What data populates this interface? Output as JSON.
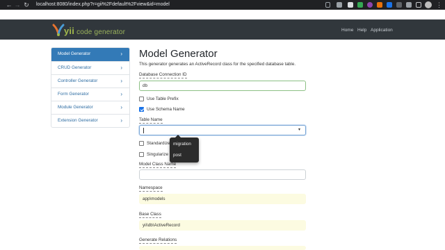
{
  "browser": {
    "url": "localhost:8080/index.php?r=gii%2Fdefault%2Fview&id=model",
    "back": "←",
    "forward": "→",
    "reload": "↻",
    "menu": "⋮"
  },
  "header": {
    "brand": "yii",
    "brand_suffix": "code generator",
    "nav": [
      "Home",
      "Help",
      "Application"
    ]
  },
  "sidebar": {
    "items": [
      {
        "label": "Model Generator",
        "active": true
      },
      {
        "label": "CRUD Generator",
        "active": false
      },
      {
        "label": "Controller Generator",
        "active": false
      },
      {
        "label": "Form Generator",
        "active": false
      },
      {
        "label": "Module Generator",
        "active": false
      },
      {
        "label": "Extension Generator",
        "active": false
      }
    ],
    "chevron": "›"
  },
  "main": {
    "title": "Model Generator",
    "description": "This generator generates an ActiveRecord class for the specified database table.",
    "db_label": "Database Connection ID",
    "db_value": "db",
    "use_table_prefix": "Use Table Prefix",
    "use_schema_name": "Use Schema Name",
    "table_name_label": "Table Name",
    "table_name_value": "",
    "standardize_label": "Standardize C",
    "singularize_label": "Singularize",
    "model_class_label": "Model Class Name",
    "model_class_value": "",
    "namespace_label": "Namespace",
    "namespace_value": "app\\models",
    "base_class_label": "Base Class",
    "base_class_value": "yii\\db\\ActiveRecord",
    "generate_relations_label": "Generate Relations",
    "dropdown_caret": "▾"
  },
  "autocomplete": {
    "options": [
      "migration",
      "post"
    ]
  },
  "colors": {
    "header_bg": "#31373c",
    "active_item": "#337ab7",
    "brand_green": "#a3ba4c",
    "sticky_field": "#fcfbe1"
  }
}
